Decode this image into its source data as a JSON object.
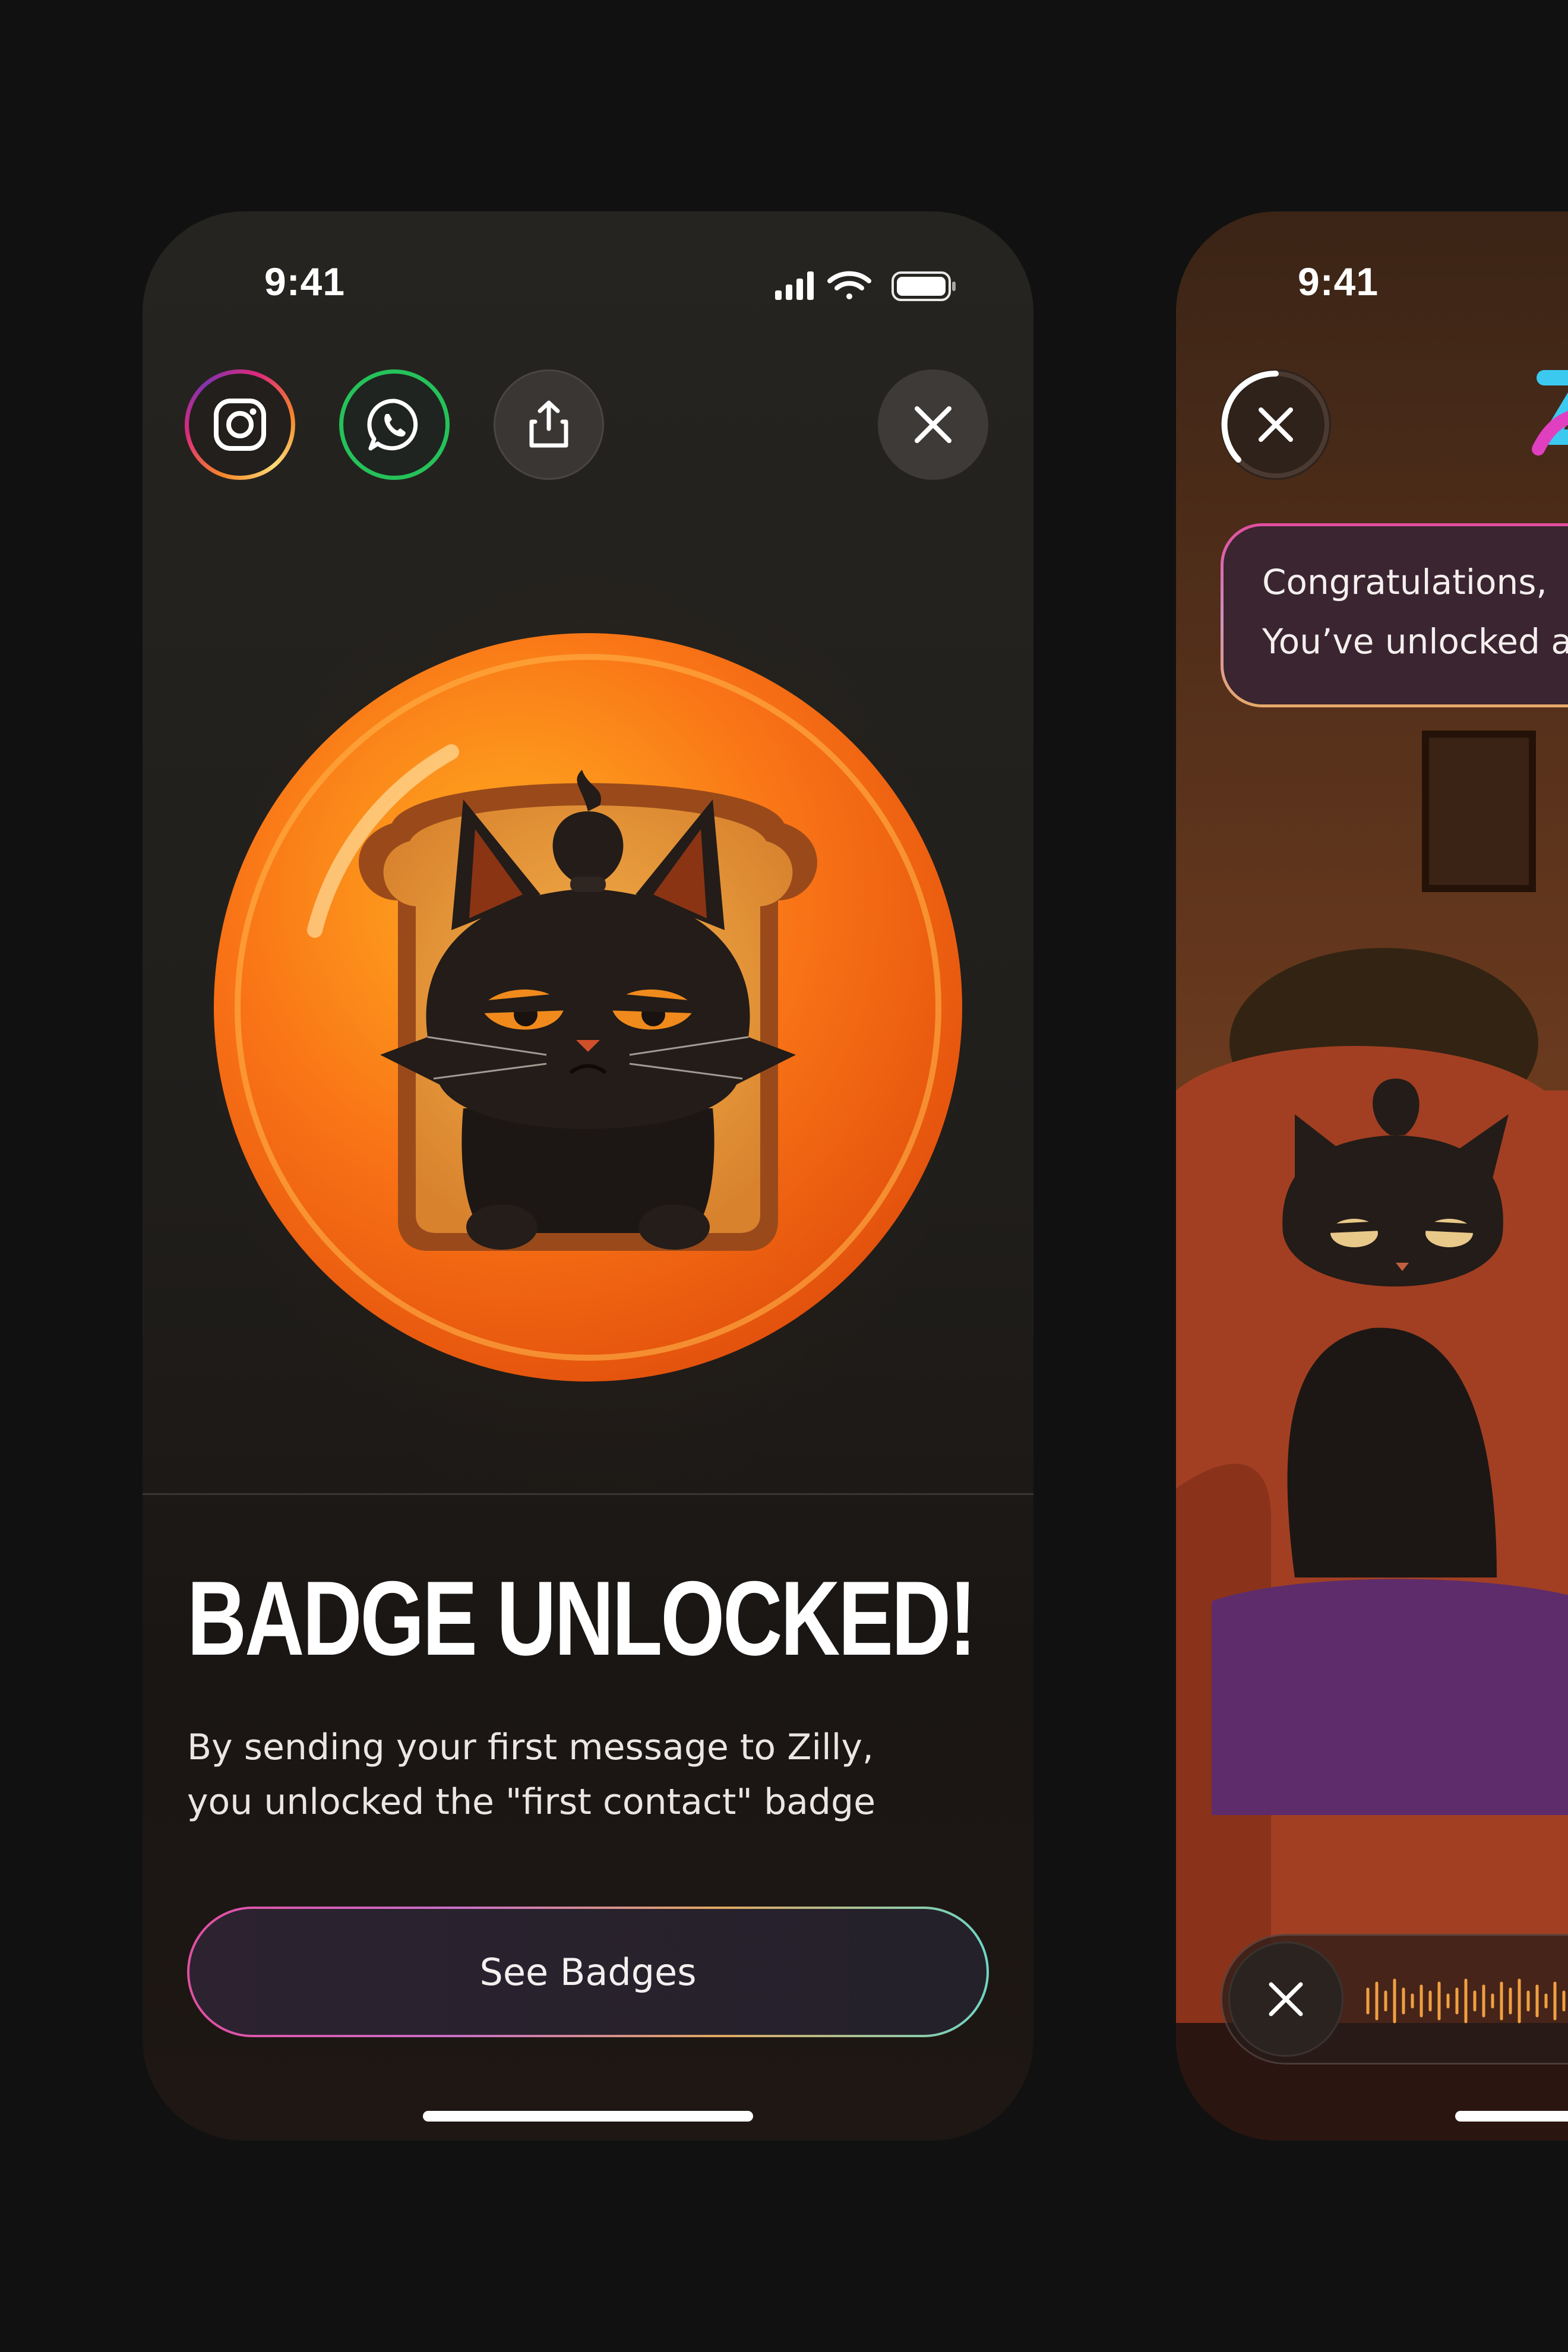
{
  "left_screen": {
    "status_bar": {
      "time": "9:41"
    },
    "share_buttons": [
      {
        "name": "instagram",
        "icon": "instagram-icon"
      },
      {
        "name": "whatsapp",
        "icon": "whatsapp-icon"
      },
      {
        "name": "share",
        "icon": "share-upload-icon"
      }
    ],
    "close_icon": "close-icon",
    "badge": {
      "icon": "grumpy-cat-toast-badge",
      "colors": {
        "outer": "#f97316",
        "inner": "#fb923c",
        "cat": "#1c1714"
      }
    },
    "title": "BADGE UNLOCKED!",
    "description_line1": "By sending your first message to Zilly,",
    "description_line2": "you unlocked the \"first contact\" badge",
    "cta_label": "See Badges"
  },
  "right_screen": {
    "status_bar": {
      "time": "9:41"
    },
    "close_icon": "close-icon",
    "logo_icon": "zilly-logo-icon",
    "congrats_line1": "Congratulations,",
    "congrats_line2": "You’ve unlocked a",
    "scene": "grumpy-cat-on-armchair",
    "voice_close_icon": "close-icon",
    "waveform_icon": "audio-waveform-icon"
  },
  "colors": {
    "background": "#111111",
    "whatsapp_green": "#25c25a",
    "accent_pink": "#e04fa0",
    "accent_teal": "#6fd6c4",
    "waveform_orange": "#f0a040"
  }
}
